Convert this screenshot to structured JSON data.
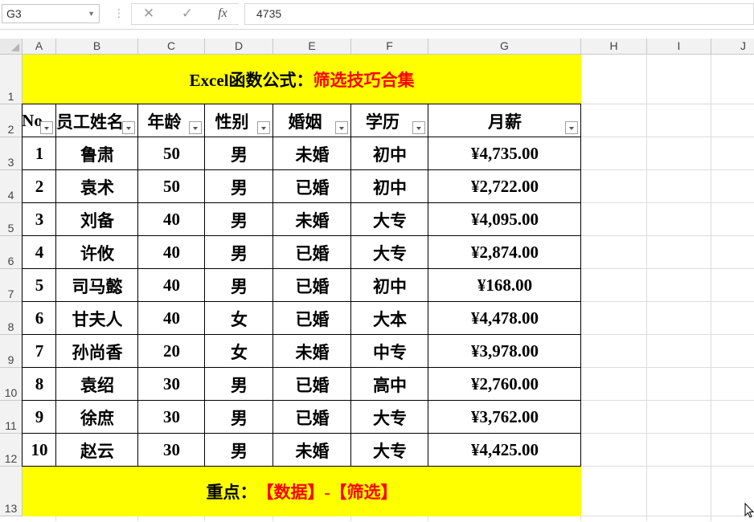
{
  "formula_bar": {
    "cell_ref": "G3",
    "cancel_icon": "✕",
    "enter_icon": "✓",
    "fx_label": "fx",
    "value": "4735"
  },
  "columns": [
    "A",
    "B",
    "C",
    "D",
    "E",
    "F",
    "G",
    "H",
    "I",
    "J"
  ],
  "rows": [
    "1",
    "2",
    "3",
    "4",
    "5",
    "6",
    "7",
    "8",
    "9",
    "10",
    "11",
    "12",
    "13"
  ],
  "title": {
    "part1": "Excel函数公式：",
    "part2": "筛选技巧合集"
  },
  "headers": [
    "No",
    "员工姓名",
    "年龄",
    "性别",
    "婚姻",
    "学历",
    "月薪"
  ],
  "data_rows": [
    [
      "1",
      "鲁肃",
      "50",
      "男",
      "未婚",
      "初中",
      "¥4,735.00"
    ],
    [
      "2",
      "袁术",
      "50",
      "男",
      "已婚",
      "初中",
      "¥2,722.00"
    ],
    [
      "3",
      "刘备",
      "40",
      "男",
      "未婚",
      "大专",
      "¥4,095.00"
    ],
    [
      "4",
      "许攸",
      "40",
      "男",
      "已婚",
      "大专",
      "¥2,874.00"
    ],
    [
      "5",
      "司马懿",
      "40",
      "男",
      "已婚",
      "初中",
      "¥168.00"
    ],
    [
      "6",
      "甘夫人",
      "40",
      "女",
      "已婚",
      "大本",
      "¥4,478.00"
    ],
    [
      "7",
      "孙尚香",
      "20",
      "女",
      "未婚",
      "中专",
      "¥3,978.00"
    ],
    [
      "8",
      "袁绍",
      "30",
      "男",
      "已婚",
      "高中",
      "¥2,760.00"
    ],
    [
      "9",
      "徐庶",
      "30",
      "男",
      "已婚",
      "大专",
      "¥3,762.00"
    ],
    [
      "10",
      "赵云",
      "30",
      "男",
      "未婚",
      "大专",
      "¥4,425.00"
    ]
  ],
  "footer": {
    "part1": "重点：",
    "part2": "【数据】-【筛选】"
  },
  "colors": {
    "highlight": "#ffff00",
    "accent_text": "#ff0000"
  }
}
